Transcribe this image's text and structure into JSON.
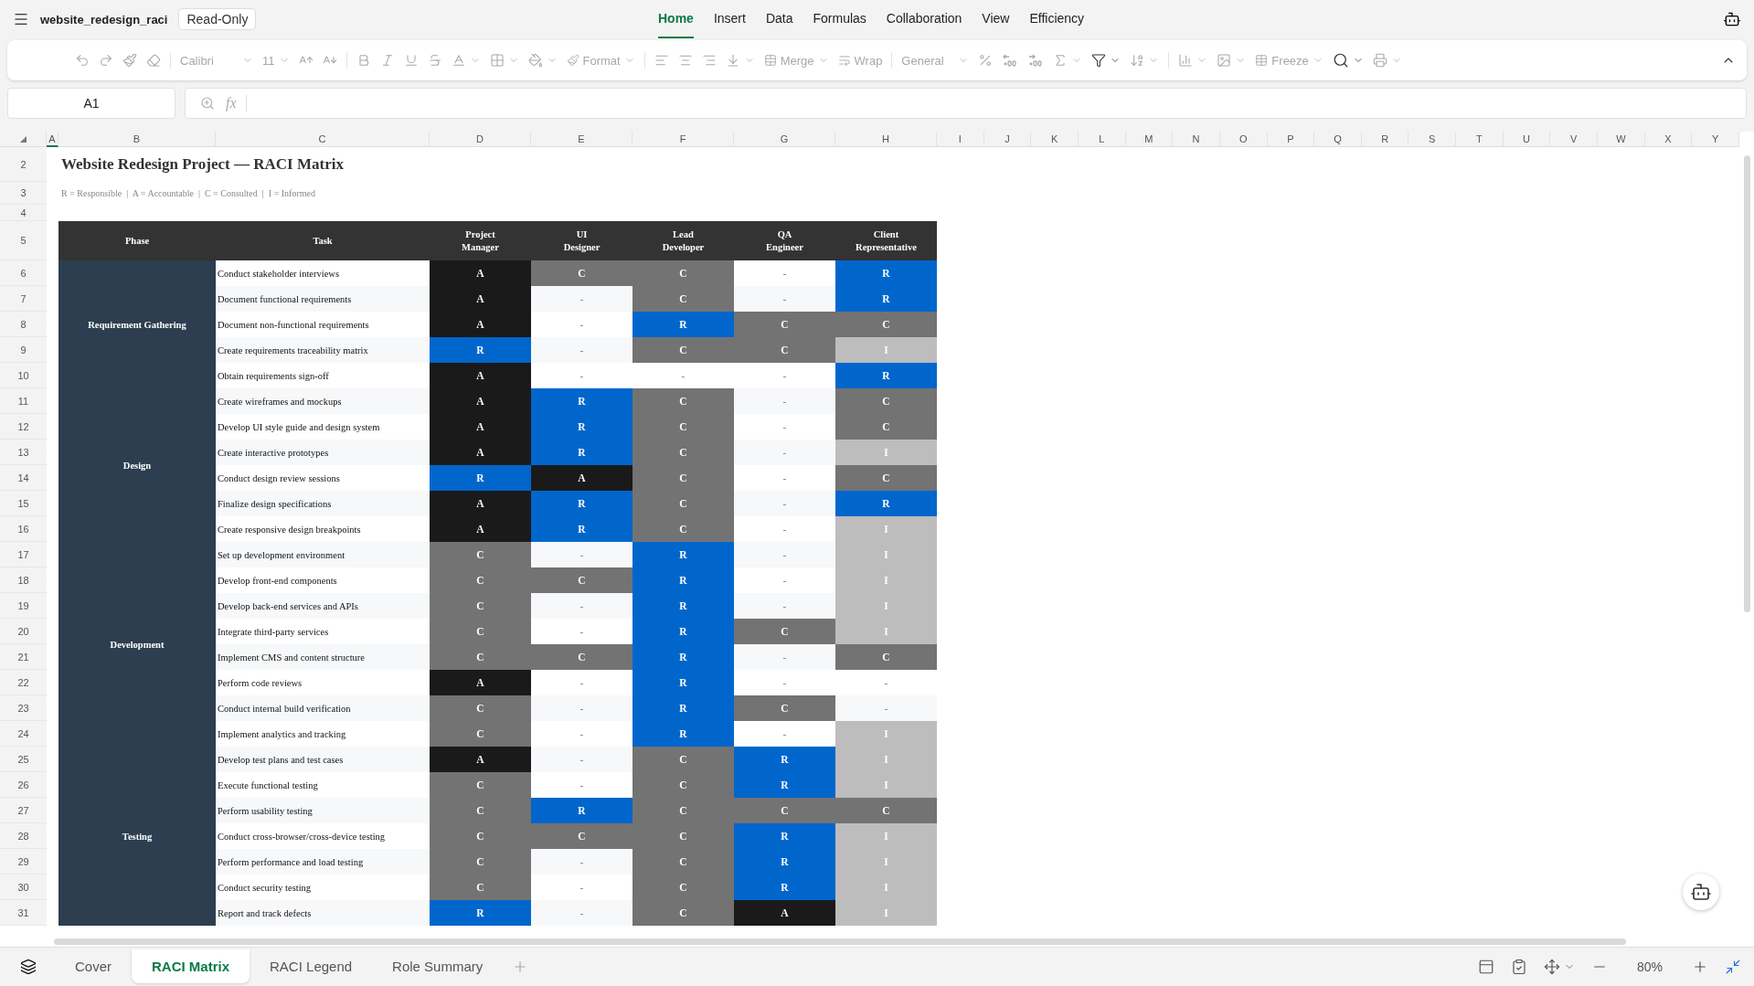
{
  "app": {
    "file_name": "website_redesign_raci",
    "badge": "Read-Only"
  },
  "menu_tabs": [
    {
      "label": "Home",
      "selected": true
    },
    {
      "label": "Insert",
      "selected": false
    },
    {
      "label": "Data",
      "selected": false
    },
    {
      "label": "Formulas",
      "selected": false
    },
    {
      "label": "Collaboration",
      "selected": false
    },
    {
      "label": "View",
      "selected": false
    },
    {
      "label": "Efficiency",
      "selected": false
    }
  ],
  "toolbar": {
    "disabled": true,
    "font": "Calibri",
    "font_size": "11",
    "format": "Format",
    "merge": "Merge",
    "wrap": "Wrap",
    "number_format": "General",
    "freeze": "Freeze"
  },
  "formula_bar": {
    "cell": "A1",
    "fx": "fx"
  },
  "columns": [
    {
      "label": "A",
      "selected": true
    },
    {
      "label": "B",
      "selected": false
    },
    {
      "label": "C",
      "selected": false
    },
    {
      "label": "D",
      "selected": false
    },
    {
      "label": "E",
      "selected": false
    },
    {
      "label": "F",
      "selected": false
    },
    {
      "label": "G",
      "selected": false
    },
    {
      "label": "H",
      "selected": false
    },
    {
      "label": "I",
      "selected": false
    },
    {
      "label": "J",
      "selected": false
    },
    {
      "label": "K",
      "selected": false
    },
    {
      "label": "L",
      "selected": false
    },
    {
      "label": "M",
      "selected": false
    },
    {
      "label": "N",
      "selected": false
    },
    {
      "label": "O",
      "selected": false
    },
    {
      "label": "P",
      "selected": false
    },
    {
      "label": "Q",
      "selected": false
    },
    {
      "label": "R",
      "selected": false
    },
    {
      "label": "S",
      "selected": false
    },
    {
      "label": "T",
      "selected": false
    },
    {
      "label": "U",
      "selected": false
    },
    {
      "label": "V",
      "selected": false
    },
    {
      "label": "W",
      "selected": false
    },
    {
      "label": "X",
      "selected": false
    },
    {
      "label": "Y",
      "selected": false
    }
  ],
  "row_numbers": [
    "2",
    "3",
    "4",
    "5",
    "6",
    "7",
    "8",
    "9",
    "10",
    "11",
    "12",
    "13",
    "14",
    "15",
    "16",
    "17",
    "18",
    "19",
    "20",
    "21",
    "22",
    "23",
    "24",
    "25",
    "26",
    "27",
    "28",
    "29",
    "30",
    "31"
  ],
  "sheet": {
    "title": "Website Redesign Project — RACI Matrix",
    "legend": "R = Responsible  |  A = Accountable  |  C = Consulted  |  I = Informed",
    "headers": [
      "Phase",
      "Task",
      "Project Manager",
      "UI Designer",
      "Lead Developer",
      "QA Engineer",
      "Client Representative"
    ],
    "phases": [
      {
        "name": "Requirement Gathering",
        "tasks": [
          {
            "task": "Conduct stakeholder interviews",
            "roles": [
              "A",
              "C",
              "C",
              "-",
              "R"
            ]
          },
          {
            "task": "Document functional requirements",
            "roles": [
              "A",
              "-",
              "C",
              "-",
              "R"
            ]
          },
          {
            "task": "Document non-functional requirements",
            "roles": [
              "A",
              "-",
              "R",
              "C",
              "C"
            ]
          },
          {
            "task": "Create requirements traceability matrix",
            "roles": [
              "R",
              "-",
              "C",
              "C",
              "I"
            ]
          },
          {
            "task": "Obtain requirements sign-off",
            "roles": [
              "A",
              "-",
              "-",
              "-",
              "R"
            ]
          }
        ]
      },
      {
        "name": "Design",
        "tasks": [
          {
            "task": "Create wireframes and mockups",
            "roles": [
              "A",
              "R",
              "C",
              "-",
              "C"
            ]
          },
          {
            "task": "Develop UI style guide and design system",
            "roles": [
              "A",
              "R",
              "C",
              "-",
              "C"
            ]
          },
          {
            "task": "Create interactive prototypes",
            "roles": [
              "A",
              "R",
              "C",
              "-",
              "I"
            ]
          },
          {
            "task": "Conduct design review sessions",
            "roles": [
              "R",
              "A",
              "C",
              "-",
              "C"
            ]
          },
          {
            "task": "Finalize design specifications",
            "roles": [
              "A",
              "R",
              "C",
              "-",
              "R"
            ]
          },
          {
            "task": "Create responsive design breakpoints",
            "roles": [
              "A",
              "R",
              "C",
              "-",
              "I"
            ]
          }
        ]
      },
      {
        "name": "Development",
        "tasks": [
          {
            "task": "Set up development environment",
            "roles": [
              "C",
              "-",
              "R",
              "-",
              "I"
            ]
          },
          {
            "task": "Develop front-end components",
            "roles": [
              "C",
              "C",
              "R",
              "-",
              "I"
            ]
          },
          {
            "task": "Develop back-end services and APIs",
            "roles": [
              "C",
              "-",
              "R",
              "-",
              "I"
            ]
          },
          {
            "task": "Integrate third-party services",
            "roles": [
              "C",
              "-",
              "R",
              "C",
              "I"
            ]
          },
          {
            "task": "Implement CMS and content structure",
            "roles": [
              "C",
              "C",
              "R",
              "-",
              "C"
            ]
          },
          {
            "task": "Perform code reviews",
            "roles": [
              "A",
              "-",
              "R",
              "-",
              "-"
            ]
          },
          {
            "task": "Conduct internal build verification",
            "roles": [
              "C",
              "-",
              "R",
              "C",
              "-"
            ]
          },
          {
            "task": "Implement analytics and tracking",
            "roles": [
              "C",
              "-",
              "R",
              "-",
              "I"
            ]
          }
        ]
      },
      {
        "name": "Testing",
        "tasks": [
          {
            "task": "Develop test plans and test cases",
            "roles": [
              "A",
              "-",
              "C",
              "R",
              "I"
            ]
          },
          {
            "task": "Execute functional testing",
            "roles": [
              "C",
              "-",
              "C",
              "R",
              "I"
            ]
          },
          {
            "task": "Perform usability testing",
            "roles": [
              "C",
              "R",
              "C",
              "C",
              "C"
            ]
          },
          {
            "task": "Conduct cross-browser/cross-device testing",
            "roles": [
              "C",
              "C",
              "C",
              "R",
              "I"
            ]
          },
          {
            "task": "Perform performance and load testing",
            "roles": [
              "C",
              "-",
              "C",
              "R",
              "I"
            ]
          },
          {
            "task": "Conduct security testing",
            "roles": [
              "C",
              "-",
              "C",
              "R",
              "I"
            ]
          },
          {
            "task": "Report and track defects",
            "roles": [
              "R",
              "-",
              "C",
              "A",
              "I"
            ]
          }
        ]
      }
    ]
  },
  "sheet_tabs": [
    {
      "label": "Cover",
      "selected": false
    },
    {
      "label": "RACI Matrix",
      "selected": true
    },
    {
      "label": "RACI Legend",
      "selected": false
    },
    {
      "label": "Role Summary",
      "selected": false
    }
  ],
  "zoom": "80%"
}
